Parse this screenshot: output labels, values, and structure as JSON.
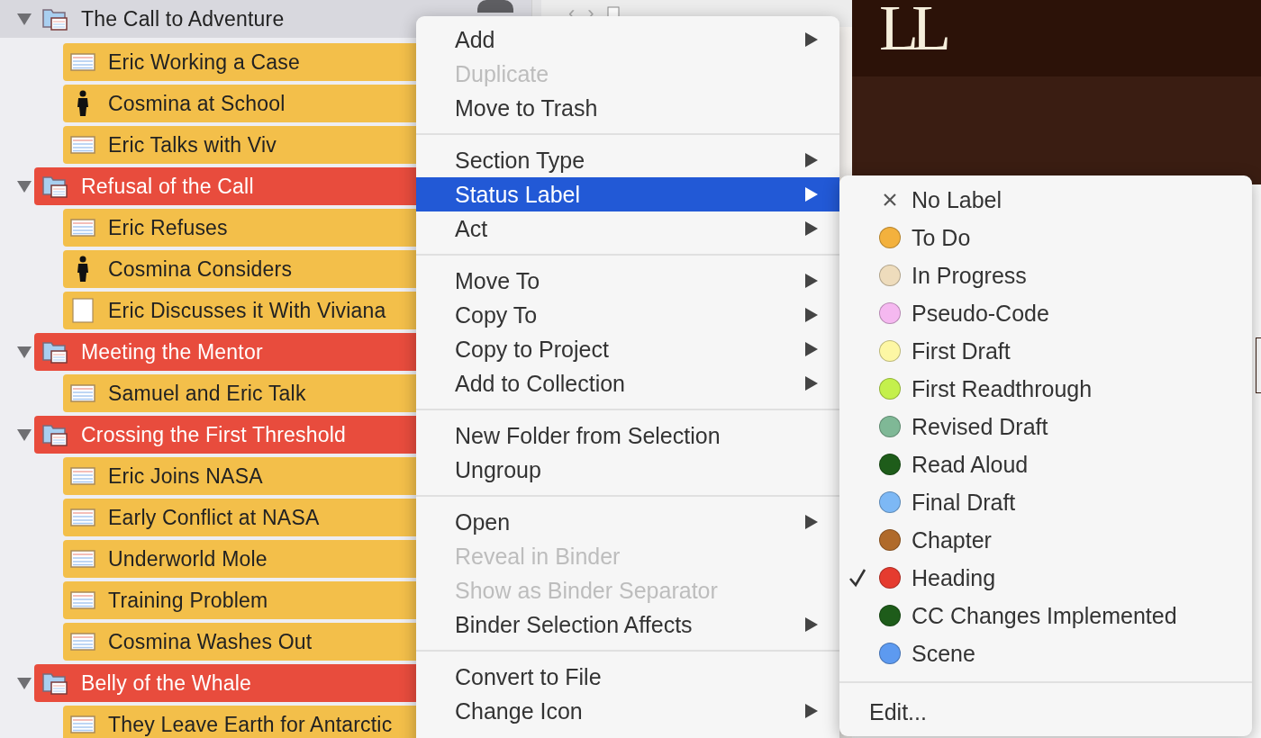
{
  "toolbar": {
    "back": "‹",
    "forward": "›"
  },
  "binder": {
    "items": [
      {
        "kind": "folder",
        "label": "The Call to Adventure",
        "selected": true,
        "expanded": true,
        "children": [
          {
            "kind": "text",
            "label": "Eric Working a Case",
            "color": "#f3bf4a",
            "selected": false
          },
          {
            "kind": "character",
            "label": "Cosmina at School",
            "color": "#f3bf4a",
            "selected": false
          },
          {
            "kind": "text",
            "label": "Eric Talks with Viv",
            "color": "#f3bf4a",
            "selected": false
          }
        ]
      },
      {
        "kind": "folder",
        "label": "Refusal of the Call",
        "color": "#e84c3d",
        "selected": false,
        "expanded": true,
        "children": [
          {
            "kind": "text",
            "label": "Eric Refuses",
            "color": "#f3bf4a",
            "selected": false
          },
          {
            "kind": "character",
            "label": "Cosmina Considers",
            "color": "#f3bf4a",
            "selected": false
          },
          {
            "kind": "blank",
            "label": "Eric Discusses it With Viviana",
            "color": "#f3bf4a",
            "selected": false
          }
        ]
      },
      {
        "kind": "folder",
        "label": "Meeting the Mentor",
        "color": "#e84c3d",
        "selected": false,
        "expanded": true,
        "children": [
          {
            "kind": "text",
            "label": "Samuel and Eric Talk",
            "color": "#f3bf4a",
            "selected": false
          }
        ]
      },
      {
        "kind": "folder",
        "label": "Crossing the First Threshold",
        "color": "#e84c3d",
        "selected": false,
        "expanded": true,
        "children": [
          {
            "kind": "text",
            "label": "Eric Joins NASA",
            "color": "#f3bf4a",
            "selected": false
          },
          {
            "kind": "text",
            "label": "Early Conflict at NASA",
            "color": "#f3bf4a",
            "selected": false
          },
          {
            "kind": "text",
            "label": "Underworld Mole",
            "color": "#f3bf4a",
            "selected": false
          },
          {
            "kind": "text",
            "label": "Training Problem",
            "color": "#f3bf4a",
            "selected": false
          },
          {
            "kind": "text",
            "label": "Cosmina Washes Out",
            "color": "#f3bf4a",
            "selected": false
          }
        ]
      },
      {
        "kind": "folder",
        "label": "Belly of the Whale",
        "color": "#e84c3d",
        "selected": false,
        "expanded": true,
        "children": [
          {
            "kind": "text",
            "label": "They Leave Earth for Antarctic",
            "color": "#f3bf4a",
            "selected": false
          }
        ]
      }
    ]
  },
  "editor": {
    "logo": "LL"
  },
  "context_menu": {
    "items": [
      {
        "kind": "item",
        "label": "Add",
        "disabled": false,
        "submenu": true,
        "selected": false
      },
      {
        "kind": "item",
        "label": "Duplicate",
        "disabled": true,
        "submenu": false,
        "selected": false
      },
      {
        "kind": "item",
        "label": "Move to Trash",
        "disabled": false,
        "submenu": false,
        "selected": false
      },
      {
        "kind": "separator"
      },
      {
        "kind": "item",
        "label": "Section Type",
        "disabled": false,
        "submenu": true,
        "selected": false
      },
      {
        "kind": "item",
        "label": "Status Label",
        "disabled": false,
        "submenu": true,
        "selected": true
      },
      {
        "kind": "item",
        "label": "Act",
        "disabled": false,
        "submenu": true,
        "selected": false
      },
      {
        "kind": "separator"
      },
      {
        "kind": "item",
        "label": "Move To",
        "disabled": false,
        "submenu": true,
        "selected": false
      },
      {
        "kind": "item",
        "label": "Copy To",
        "disabled": false,
        "submenu": true,
        "selected": false
      },
      {
        "kind": "item",
        "label": "Copy to Project",
        "disabled": false,
        "submenu": true,
        "selected": false
      },
      {
        "kind": "item",
        "label": "Add to Collection",
        "disabled": false,
        "submenu": true,
        "selected": false
      },
      {
        "kind": "separator"
      },
      {
        "kind": "item",
        "label": "New Folder from Selection",
        "disabled": false,
        "submenu": false,
        "selected": false
      },
      {
        "kind": "item",
        "label": "Ungroup",
        "disabled": false,
        "submenu": false,
        "selected": false
      },
      {
        "kind": "separator"
      },
      {
        "kind": "item",
        "label": "Open",
        "disabled": false,
        "submenu": true,
        "selected": false
      },
      {
        "kind": "item",
        "label": "Reveal in Binder",
        "disabled": true,
        "submenu": false,
        "selected": false
      },
      {
        "kind": "item",
        "label": "Show as Binder Separator",
        "disabled": true,
        "submenu": false,
        "selected": false
      },
      {
        "kind": "item",
        "label": "Binder Selection Affects",
        "disabled": false,
        "submenu": true,
        "selected": false
      },
      {
        "kind": "separator"
      },
      {
        "kind": "item",
        "label": "Convert to File",
        "disabled": false,
        "submenu": false,
        "selected": false
      },
      {
        "kind": "item",
        "label": "Change Icon",
        "disabled": false,
        "submenu": true,
        "selected": false
      }
    ]
  },
  "status_submenu": {
    "items": [
      {
        "kind": "none",
        "label": "No Label",
        "checked": false
      },
      {
        "kind": "color",
        "label": "To Do",
        "color": "#f3b13d",
        "checked": false
      },
      {
        "kind": "color",
        "label": "In Progress",
        "color": "#eedcbc",
        "checked": false
      },
      {
        "kind": "color",
        "label": "Pseudo-Code",
        "color": "#f5b8f0",
        "checked": false
      },
      {
        "kind": "color",
        "label": "First Draft",
        "color": "#fdf7a4",
        "checked": false
      },
      {
        "kind": "color",
        "label": "First Readthrough",
        "color": "#c4f04c",
        "checked": false
      },
      {
        "kind": "color",
        "label": "Revised Draft",
        "color": "#7fb896",
        "checked": false
      },
      {
        "kind": "color",
        "label": "Read Aloud",
        "color": "#1e5c1a",
        "checked": false
      },
      {
        "kind": "color",
        "label": "Final Draft",
        "color": "#7db8f5",
        "checked": false
      },
      {
        "kind": "color",
        "label": "Chapter",
        "color": "#b06a2a",
        "checked": false
      },
      {
        "kind": "color",
        "label": "Heading",
        "color": "#e53b2f",
        "checked": true
      },
      {
        "kind": "color",
        "label": "CC Changes Implemented",
        "color": "#1e5c1a",
        "checked": false
      },
      {
        "kind": "color",
        "label": "Scene",
        "color": "#5d9af0",
        "checked": false
      },
      {
        "kind": "separator"
      },
      {
        "kind": "action",
        "label": "Edit..."
      }
    ]
  }
}
